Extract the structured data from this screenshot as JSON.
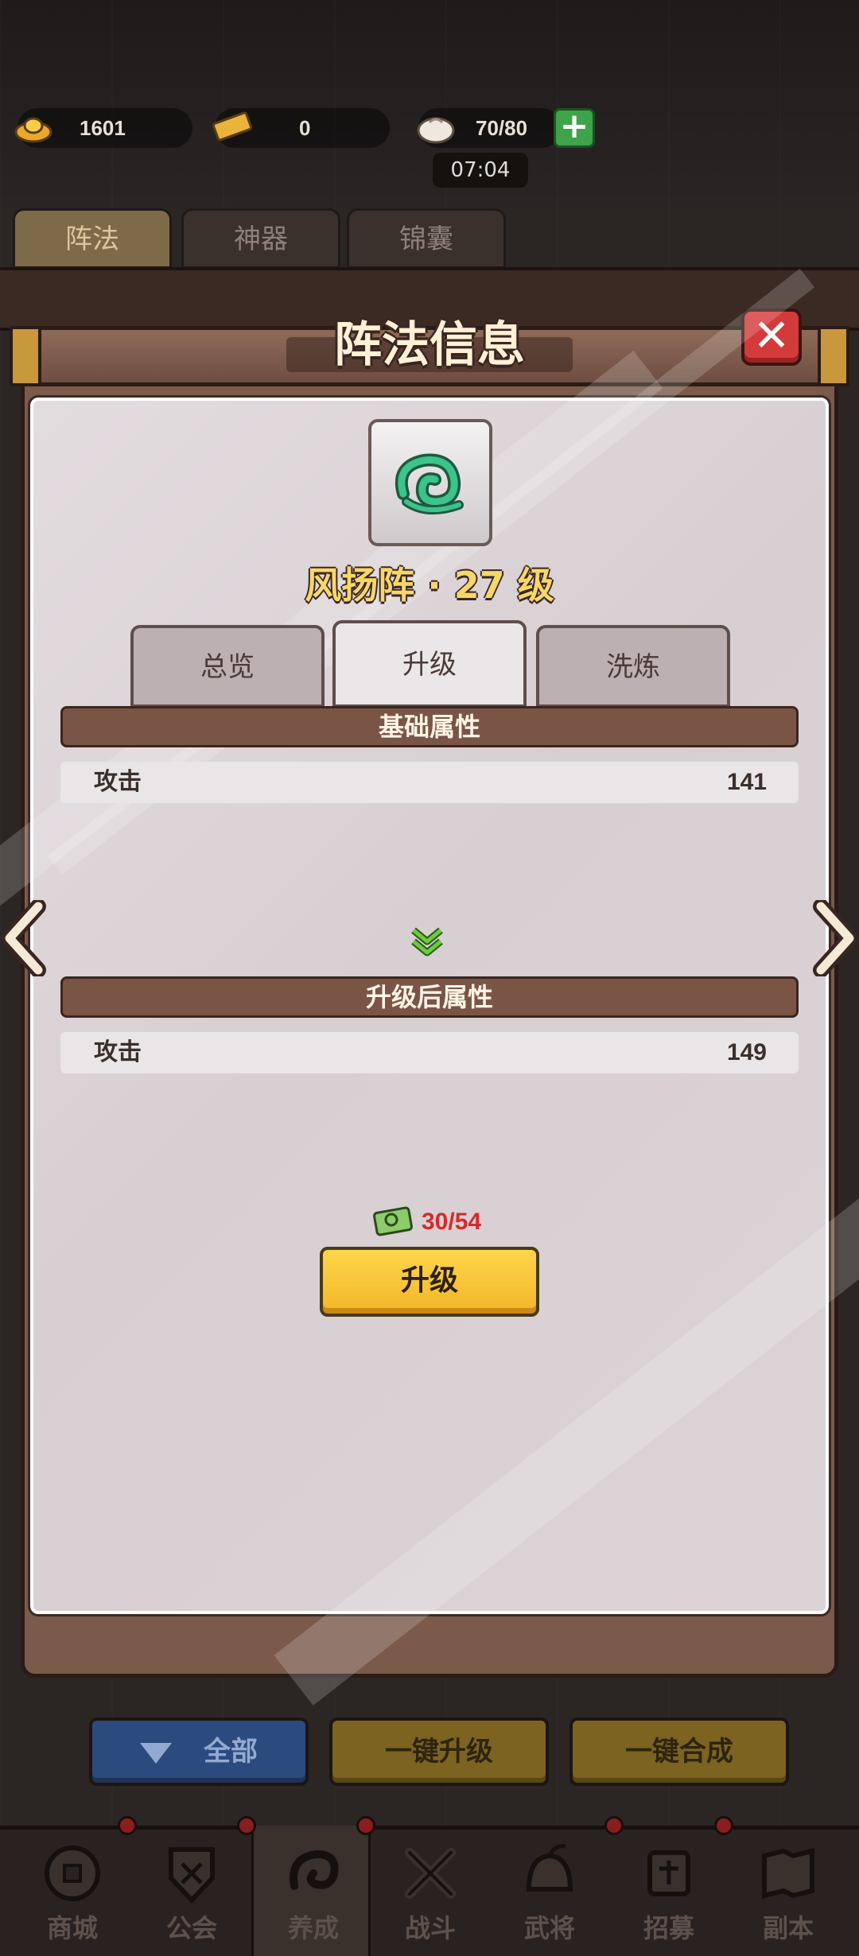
{
  "resources": {
    "gold": "1601",
    "tickets": "0",
    "stamina": "70/80",
    "timer": "07:04"
  },
  "top_tabs": [
    "阵法",
    "神器",
    "锦囊"
  ],
  "modal": {
    "title": "阵法信息",
    "formation_name": "风扬阵 · 27 级",
    "sub_tabs": [
      "总览",
      "升级",
      "洗炼"
    ],
    "base_section": {
      "title": "基础属性",
      "attr_name": "攻击",
      "attr_value": "141"
    },
    "after_section": {
      "title": "升级后属性",
      "attr_name": "攻击",
      "attr_value": "149"
    },
    "cost": "30/54",
    "upgrade_label": "升级"
  },
  "bottom_buttons": {
    "filter_label": "全部",
    "one_click_upgrade": "一键升级",
    "one_click_merge": "一键合成"
  },
  "nav": [
    "商城",
    "公会",
    "养成",
    "战斗",
    "武将",
    "招募",
    "副本"
  ],
  "colors": {
    "accent_gold": "#f6d76a",
    "cost_red": "#d62a2a",
    "upgrade_button": "#ffd54a",
    "close_red": "#d43a3a"
  }
}
